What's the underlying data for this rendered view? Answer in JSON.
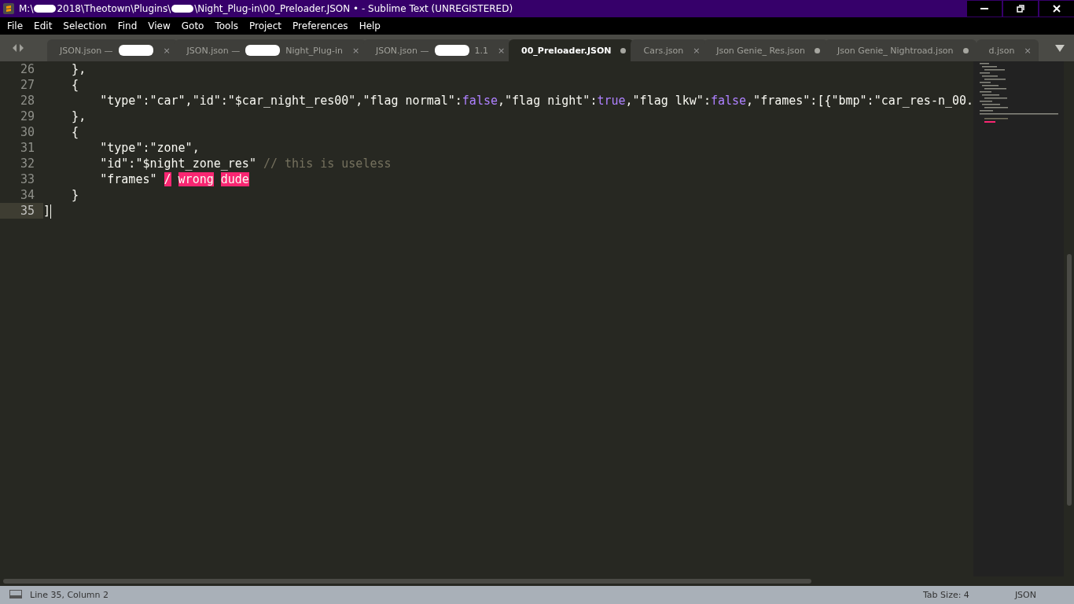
{
  "window": {
    "title_segments": [
      {
        "kind": "text",
        "text": "M:\\"
      },
      {
        "kind": "redaction"
      },
      {
        "kind": "text",
        "text": "2018\\Theotown\\Plugins\\"
      },
      {
        "kind": "redaction"
      },
      {
        "kind": "text",
        "text": "\\Night_Plug-in\\00_Preloader.JSON • - Sublime Text (UNREGISTERED)"
      }
    ]
  },
  "menu": [
    "File",
    "Edit",
    "Selection",
    "Find",
    "View",
    "Goto",
    "Tools",
    "Project",
    "Preferences",
    "Help"
  ],
  "tabs": [
    {
      "label": "JSON.json —",
      "redacted": true,
      "dirty": false,
      "selected": false,
      "close": "×"
    },
    {
      "label": "JSON.json —",
      "redacted": true,
      "suffix": "Night_Plug-in",
      "dirty": false,
      "selected": false,
      "close": "×"
    },
    {
      "label": "JSON.json —",
      "redacted": true,
      "suffix": "1.1",
      "dirty": false,
      "selected": false,
      "close": "×"
    },
    {
      "label": "00_Preloader.JSON",
      "redacted": false,
      "dirty": true,
      "selected": true
    },
    {
      "label": "Cars.json",
      "redacted": false,
      "dirty": false,
      "selected": false,
      "close": "×"
    },
    {
      "label": "Json Genie_ Res.json",
      "redacted": false,
      "dirty": true,
      "selected": false
    },
    {
      "label": "Json Genie_ Nightroad.json",
      "redacted": false,
      "dirty": true,
      "selected": false
    },
    {
      "label": "d.json",
      "redacted": false,
      "dirty": false,
      "selected": false,
      "close": "×"
    }
  ],
  "lines": [
    {
      "number": "26",
      "current": false,
      "tokens": [
        {
          "kind": "plain",
          "text": "    },"
        }
      ]
    },
    {
      "number": "27",
      "current": false,
      "tokens": [
        {
          "kind": "plain",
          "text": "    {"
        }
      ]
    },
    {
      "number": "28",
      "current": false,
      "tokens": [
        {
          "kind": "plain",
          "text": "        \"type\":\"car\",\"id\":\"$car_night_res00\",\"flag normal\":"
        },
        {
          "kind": "constant",
          "text": "false"
        },
        {
          "kind": "plain",
          "text": ",\"flag night\":"
        },
        {
          "kind": "constant",
          "text": "true"
        },
        {
          "kind": "plain",
          "text": ",\"flag lkw\":"
        },
        {
          "kind": "constant",
          "text": "false"
        },
        {
          "kind": "plain",
          "text": ",\"frames\":[{\"bmp\":\"car_res-n_00."
        }
      ]
    },
    {
      "number": "29",
      "current": false,
      "tokens": [
        {
          "kind": "plain",
          "text": "    },"
        }
      ]
    },
    {
      "number": "30",
      "current": false,
      "tokens": [
        {
          "kind": "plain",
          "text": "    {"
        }
      ]
    },
    {
      "number": "31",
      "current": false,
      "tokens": [
        {
          "kind": "plain",
          "text": "        \"type\":\"zone\","
        }
      ]
    },
    {
      "number": "32",
      "current": false,
      "tokens": [
        {
          "kind": "plain",
          "text": "        \"id\":\"$night_zone_res\" "
        },
        {
          "kind": "comment",
          "text": "// this is useless"
        }
      ]
    },
    {
      "number": "33",
      "current": false,
      "tokens": [
        {
          "kind": "plain",
          "text": "        \"frames\" "
        },
        {
          "kind": "invalid",
          "text": "/"
        },
        {
          "kind": "invalid",
          "text": "wrong"
        },
        {
          "kind": "invalid",
          "text": "dude"
        }
      ]
    },
    {
      "number": "34",
      "current": false,
      "tokens": [
        {
          "kind": "plain",
          "text": "    }"
        }
      ]
    },
    {
      "number": "35",
      "current": true,
      "tokens": [
        {
          "kind": "plain",
          "text": "]"
        }
      ]
    }
  ],
  "status_bar": {
    "position": "Line 35, Column 2",
    "tab_size": "Tab Size: 4",
    "syntax": "JSON"
  }
}
